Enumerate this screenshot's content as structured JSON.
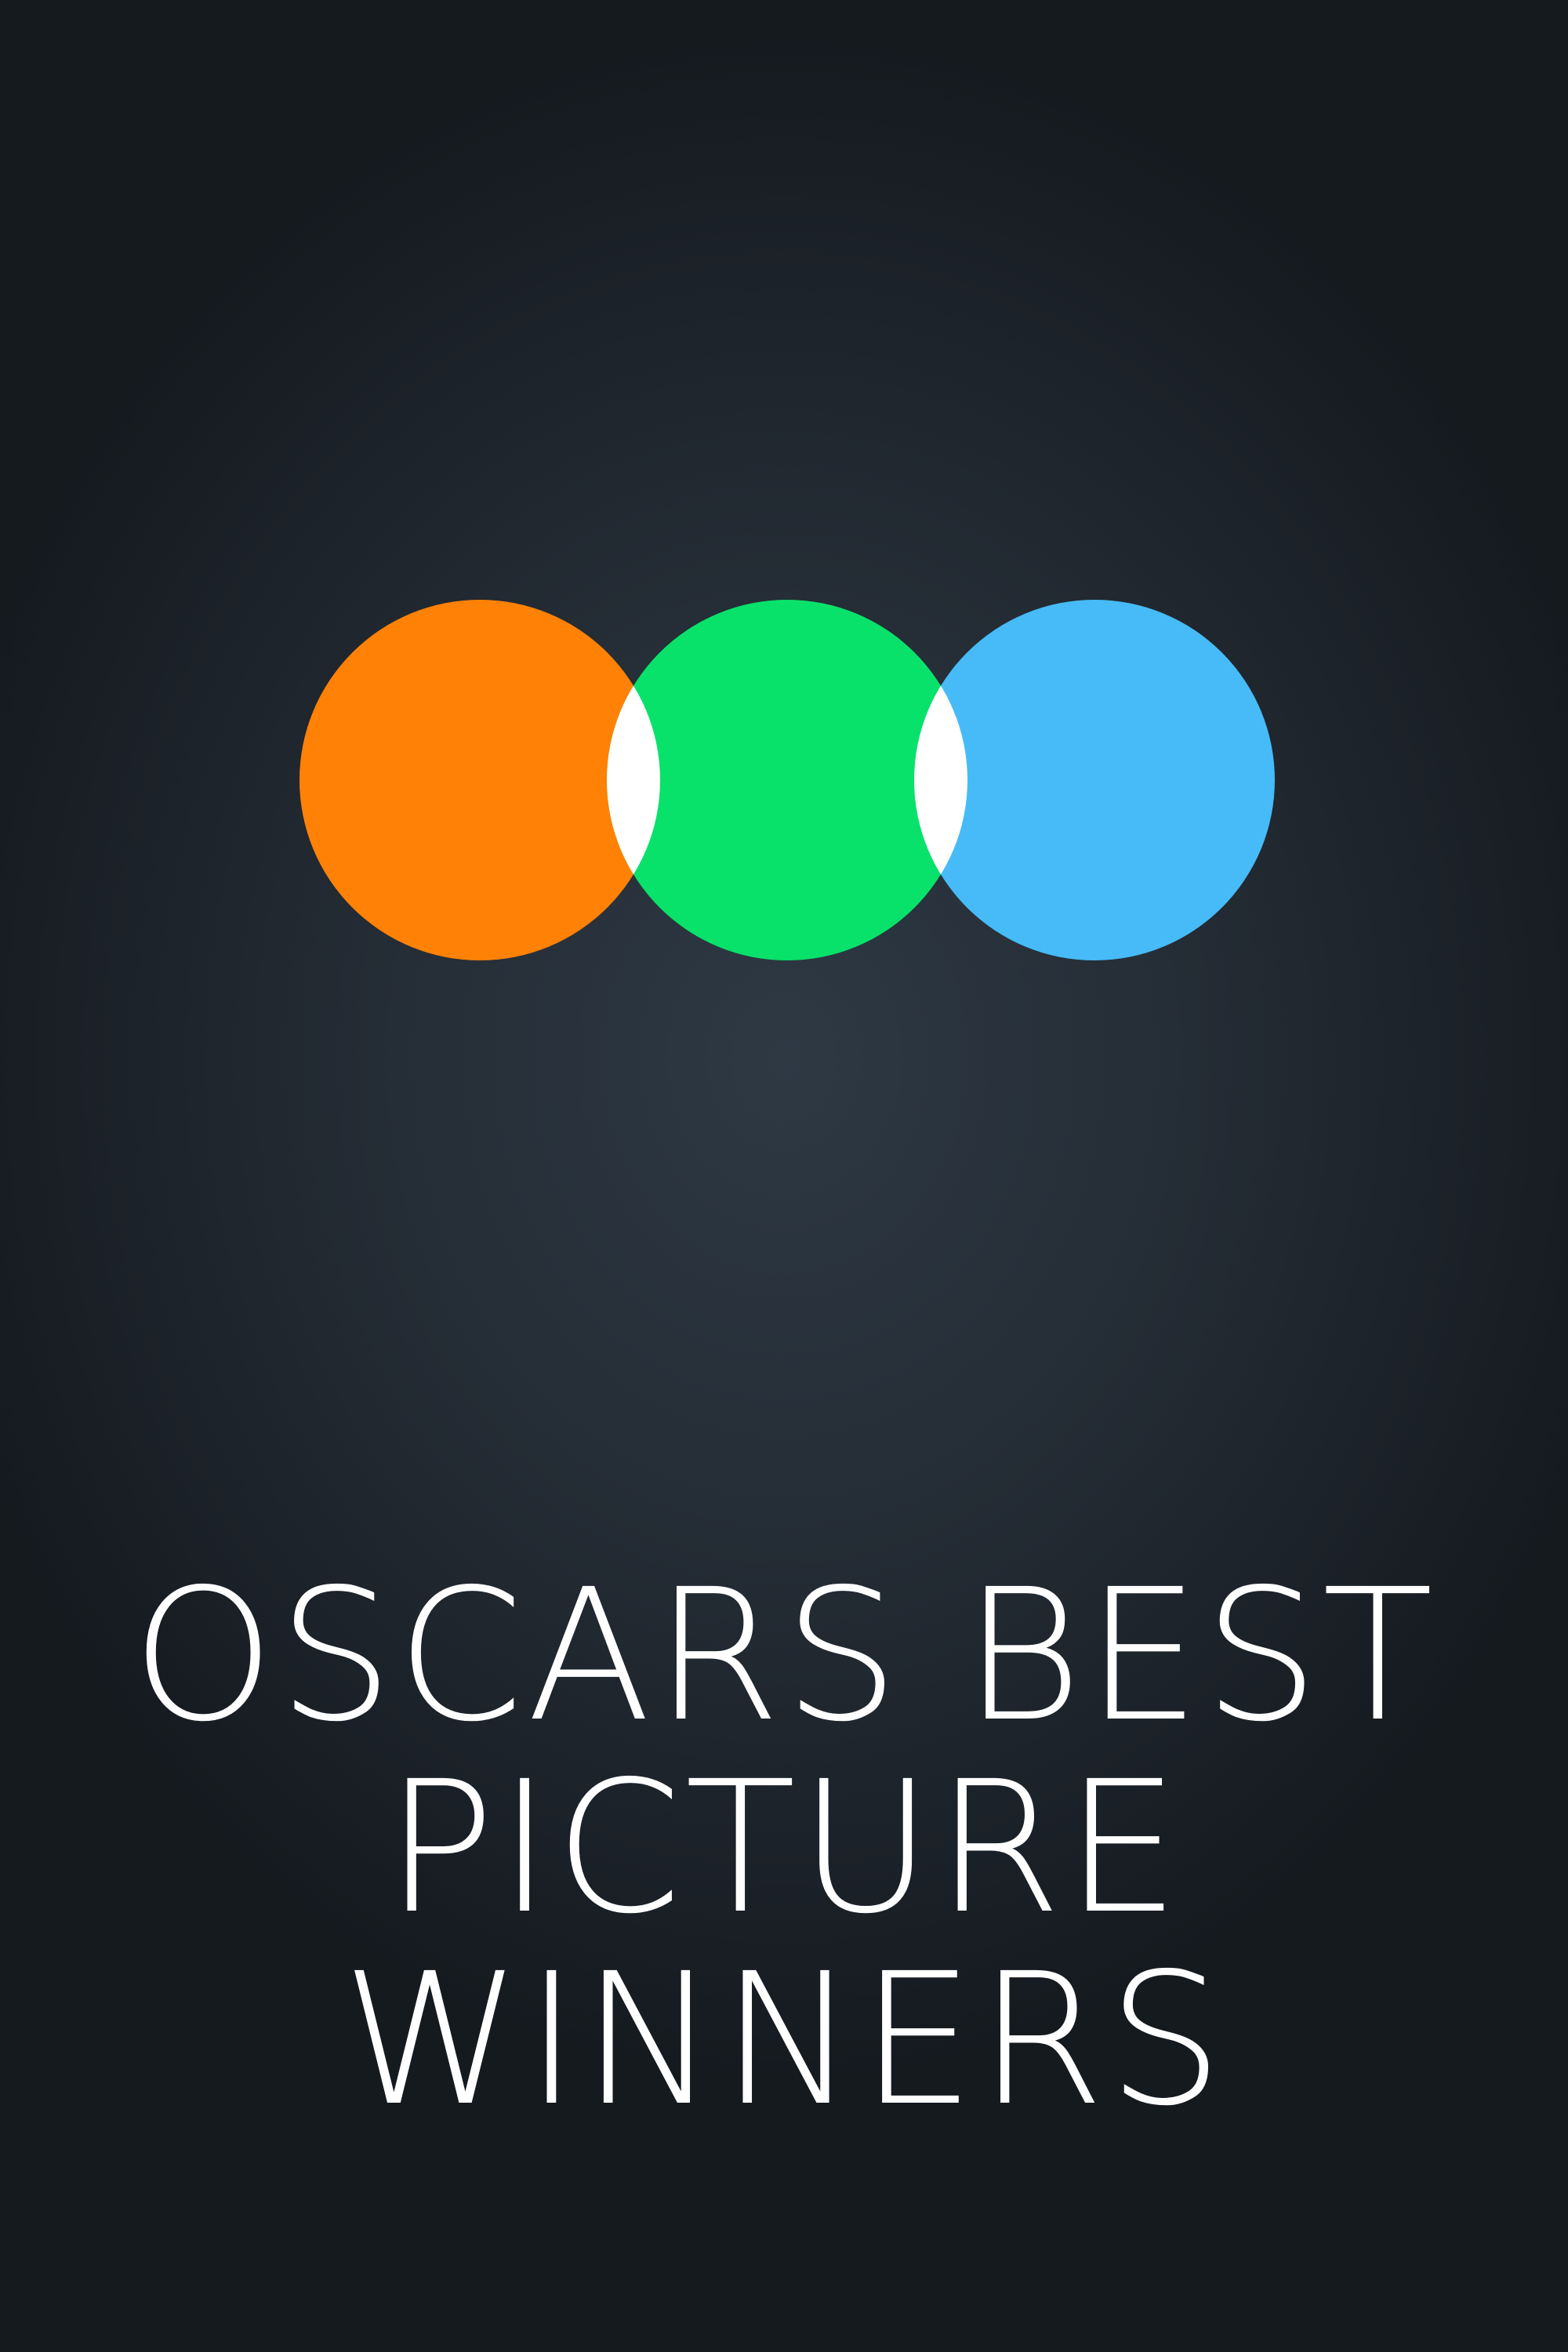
{
  "title": {
    "line1": "OSCARS BEST",
    "line2": "PICTURE",
    "line3": "WINNERS"
  },
  "logo": {
    "icon": "three-overlapping-circles-icon",
    "colors": {
      "left": "#ff8206",
      "middle": "#08e26a",
      "right": "#46bbf7",
      "overlap": "#ffffff"
    }
  },
  "background_color": "#252d36"
}
